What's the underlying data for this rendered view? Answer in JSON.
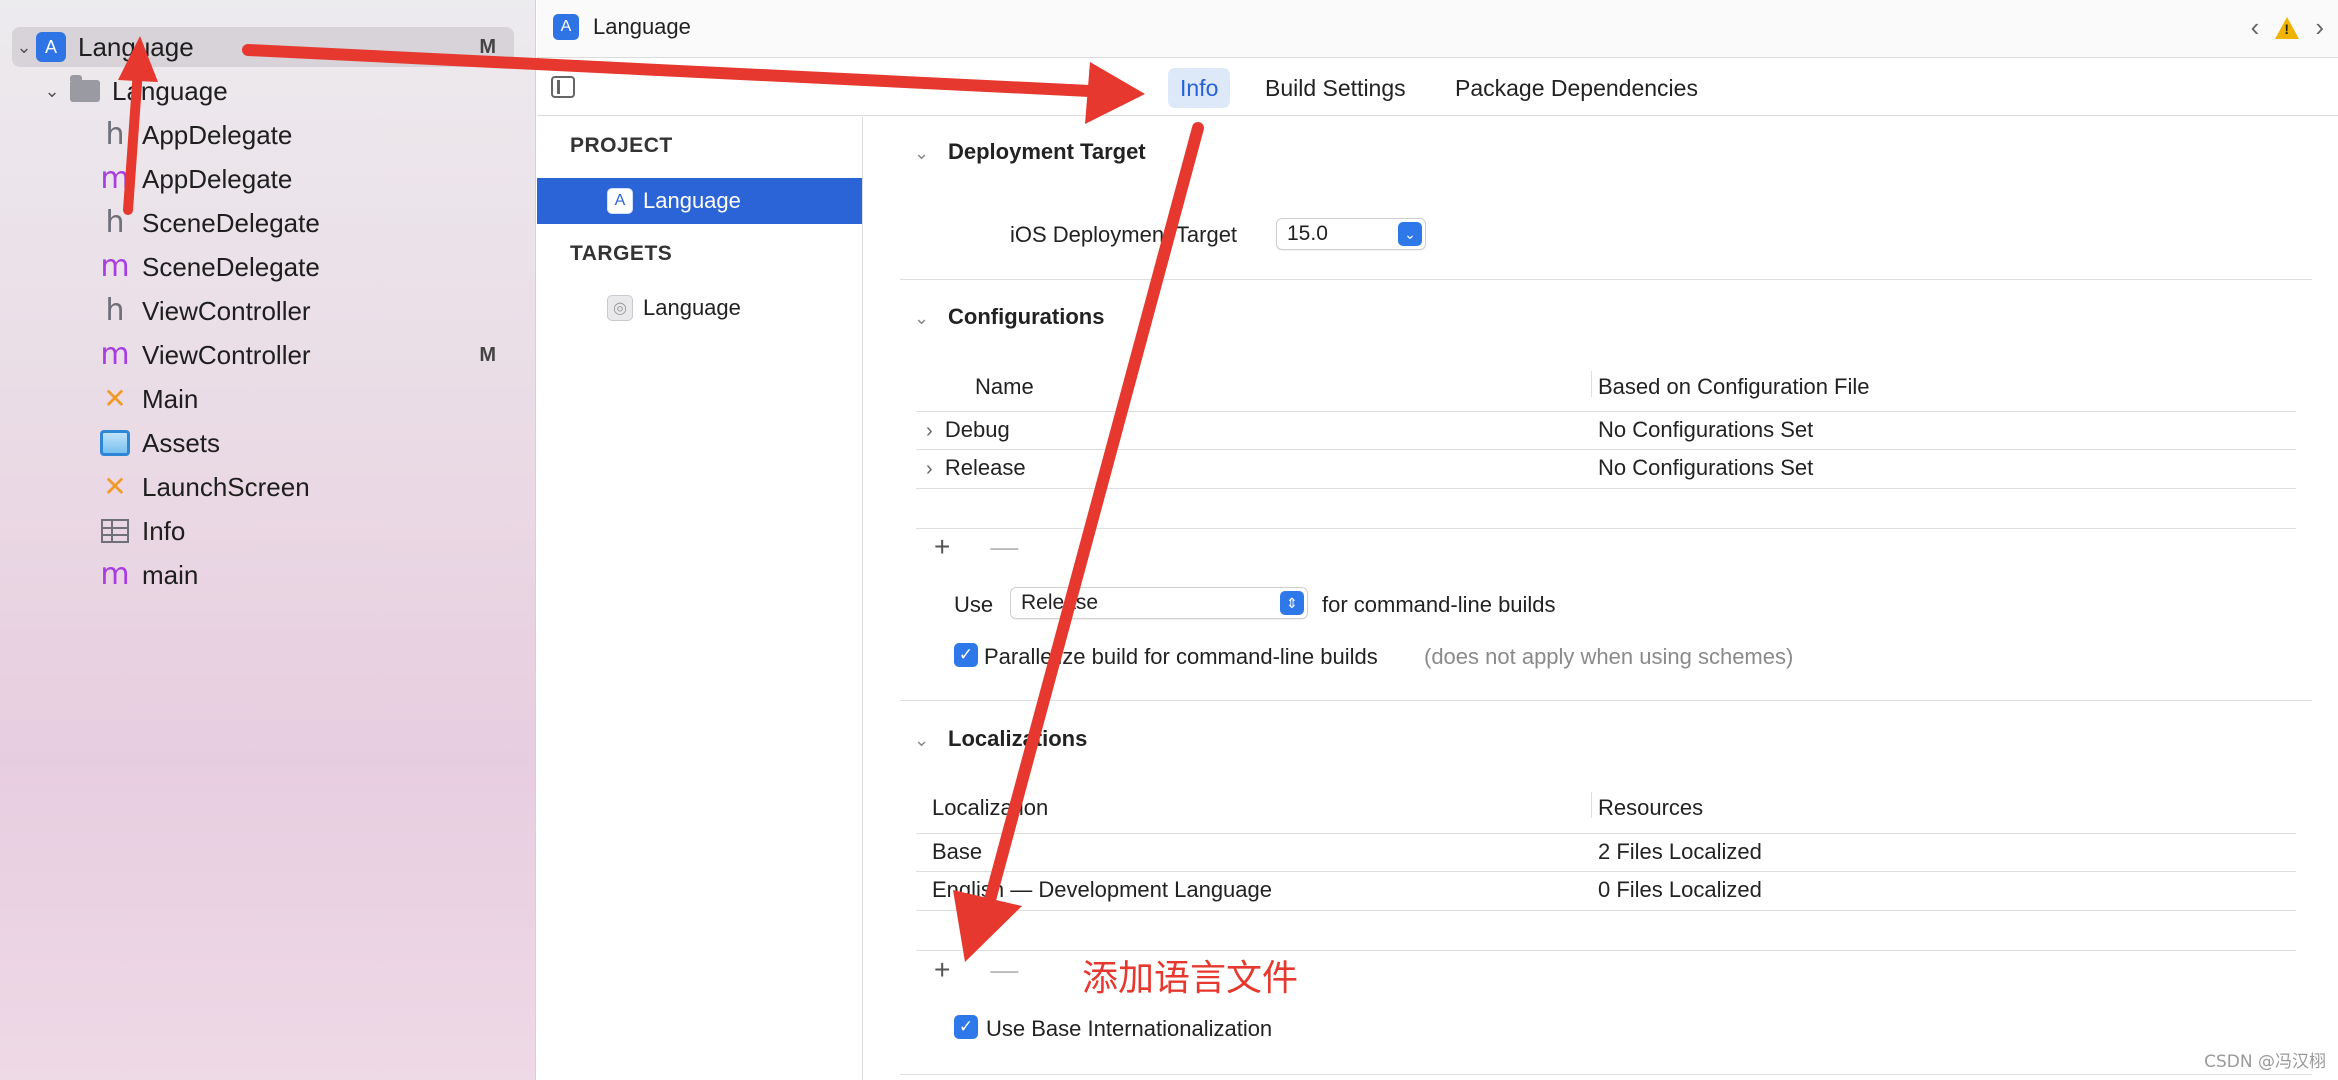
{
  "navigator": {
    "items": [
      {
        "label": "Language",
        "badge": "M",
        "icon": "app-icon"
      },
      {
        "label": "Language",
        "badge": "",
        "icon": "folder-icon"
      },
      {
        "label": "AppDelegate",
        "badge": "",
        "icon": "h"
      },
      {
        "label": "AppDelegate",
        "badge": "",
        "icon": "m"
      },
      {
        "label": "SceneDelegate",
        "badge": "",
        "icon": "h"
      },
      {
        "label": "SceneDelegate",
        "badge": "",
        "icon": "m"
      },
      {
        "label": "ViewController",
        "badge": "",
        "icon": "h"
      },
      {
        "label": "ViewController",
        "badge": "M",
        "icon": "m"
      },
      {
        "label": "Main",
        "badge": "",
        "icon": "storyboard-icon"
      },
      {
        "label": "Assets",
        "badge": "",
        "icon": "assets-icon"
      },
      {
        "label": "LaunchScreen",
        "badge": "",
        "icon": "storyboard-icon"
      },
      {
        "label": "Info",
        "badge": "",
        "icon": "plist-icon"
      },
      {
        "label": "main",
        "badge": "",
        "icon": "m"
      }
    ]
  },
  "editor": {
    "title": "Language",
    "tabs": [
      "Info",
      "Build Settings",
      "Package Dependencies"
    ]
  },
  "targets": {
    "project_heading": "PROJECT",
    "project_item": "Language",
    "targets_heading": "TARGETS",
    "target_item": "Language"
  },
  "deployment": {
    "title": "Deployment Target",
    "label": "iOS Deployment Target",
    "value": "15.0"
  },
  "configurations": {
    "title": "Configurations",
    "col_name": "Name",
    "col_file": "Based on Configuration File",
    "rows": [
      {
        "name": "Debug",
        "file": "No Configurations Set"
      },
      {
        "name": "Release",
        "file": "No Configurations Set"
      }
    ],
    "plus": "+",
    "minus": "—",
    "use_label": "Use",
    "use_value": "Release",
    "use_suffix": "for command-line builds",
    "parallelize_label": "Parallelize build for command-line builds",
    "parallelize_note": "(does not apply when using schemes)"
  },
  "localizations": {
    "title": "Localizations",
    "col_loc": "Localization",
    "col_res": "Resources",
    "rows": [
      {
        "name": "Base",
        "res": "2 Files Localized"
      },
      {
        "name": "English — Development Language",
        "res": "0 Files Localized"
      }
    ],
    "plus": "+",
    "minus": "—",
    "base_intl_label": "Use Base Internationalization"
  },
  "annotation_text": "添加语言文件",
  "watermark": "CSDN @冯汉栩",
  "colors": {
    "accent": "#2f78ea",
    "selection": "#2b64d6",
    "annotation": "#e6382e"
  }
}
